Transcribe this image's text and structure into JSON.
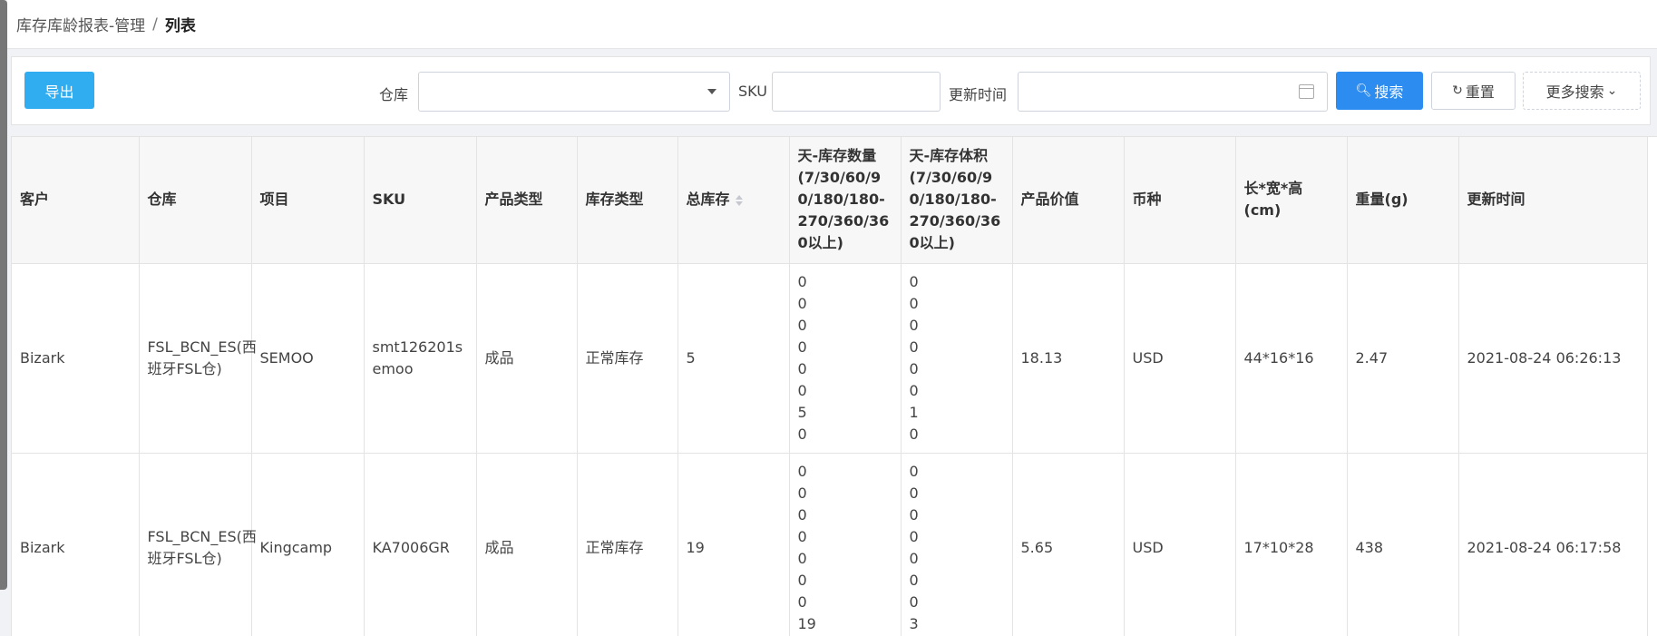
{
  "breadcrumb": {
    "parent": "库存库龄报表-管理",
    "separator": "/",
    "current": "列表"
  },
  "toolbar": {
    "export_label": "导出",
    "warehouse_label": "仓库",
    "warehouse_value": "",
    "sku_label": "SKU",
    "sku_value": "",
    "update_time_label": "更新时间",
    "update_time_value": "",
    "search_label": "搜索",
    "reset_label": "重置",
    "more_search_label": "更多搜索"
  },
  "table": {
    "columns": [
      "客户",
      "仓库",
      "项目",
      "SKU",
      "产品类型",
      "库存类型",
      "总库存",
      "天-库存数量(7/30/60/90/180/180-270/360/360以上)",
      "天-库存体积(7/30/60/90/180/180-270/360/360以上)",
      "产品价值",
      "币种",
      "长*宽*高(cm)",
      "重量(g)",
      "更新时间"
    ],
    "rows": [
      {
        "customer": "Bizark",
        "warehouse": "FSL_BCN_ES(西班牙FSL仓)",
        "project": "SEMOO",
        "sku": "smt126201semoo",
        "product_type": "成品",
        "stock_type": "正常库存",
        "total_stock": "5",
        "age_qty": "0\n0\n0\n0\n0\n0\n5\n0",
        "age_volume": "0\n0\n0\n0\n0\n0\n1\n0",
        "product_value": "18.13",
        "currency": "USD",
        "dimensions": "44*16*16",
        "weight": "2.47",
        "updated_at": "2021-08-24 06:26:13"
      },
      {
        "customer": "Bizark",
        "warehouse": "FSL_BCN_ES(西班牙FSL仓)",
        "project": "Kingcamp",
        "sku": "KA7006GR",
        "product_type": "成品",
        "stock_type": "正常库存",
        "total_stock": "19",
        "age_qty": "0\n0\n0\n0\n0\n0\n0\n19",
        "age_volume": "0\n0\n0\n0\n0\n0\n0\n3",
        "product_value": "5.65",
        "currency": "USD",
        "dimensions": "17*10*28",
        "weight": "438",
        "updated_at": "2021-08-24 06:17:58"
      }
    ]
  }
}
